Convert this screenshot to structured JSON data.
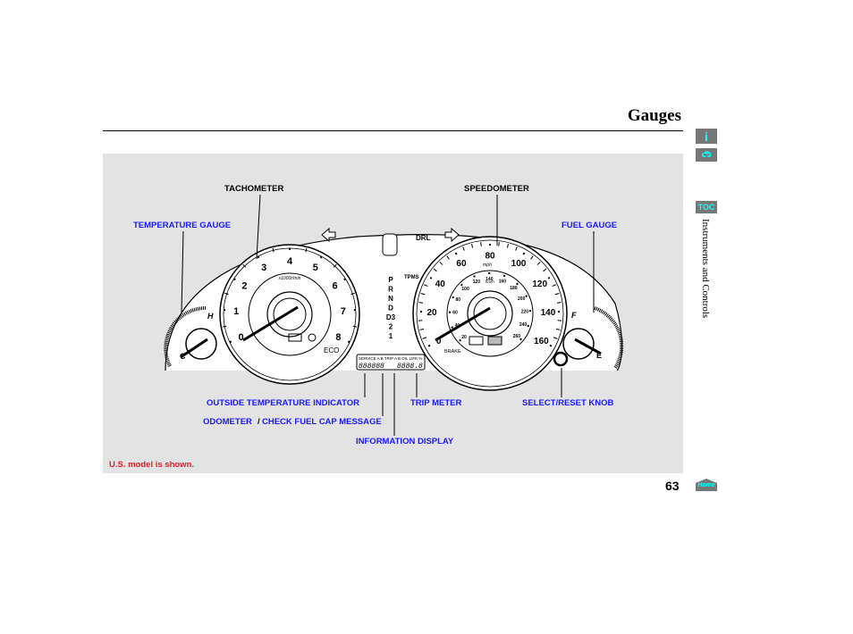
{
  "header": {
    "title": "Gauges",
    "page_number": "63"
  },
  "sidebar": {
    "info_icon": "info-icon",
    "car_icon": "car-icon",
    "toc_label": "TOC",
    "section": "Instruments and Controls",
    "home_label": "Home"
  },
  "labels": {
    "tachometer": "TACHOMETER",
    "speedometer": "SPEEDOMETER",
    "temperature_gauge": "TEMPERATURE GAUGE",
    "fuel_gauge": "FUEL GAUGE",
    "outside_temp": "OUTSIDE TEMPERATURE INDICATOR",
    "trip_meter": "TRIP METER",
    "select_reset": "SELECT/RESET KNOB",
    "odometer": "ODOMETER",
    "slash": "/",
    "check_fuel_cap": "CHECK FUEL CAP MESSAGE",
    "info_display": "INFORMATION DISPLAY",
    "note": "U.S. model is shown."
  },
  "cluster": {
    "tach_numbers": [
      "0",
      "1",
      "2",
      "3",
      "4",
      "5",
      "6",
      "7",
      "8"
    ],
    "tach_unit": "x1000r/min",
    "speed_mph": [
      "0",
      "20",
      "40",
      "60",
      "80",
      "100",
      "120",
      "140",
      "160"
    ],
    "speed_unit": "mph",
    "speed_kmh": [
      "20",
      "40",
      "60",
      "80",
      "100",
      "120",
      "140",
      "160",
      "180",
      "200",
      "220",
      "240",
      "260"
    ],
    "kmh_unit": "km/h",
    "gear": [
      "P",
      "R",
      "N",
      "D",
      "D3",
      "2",
      "1"
    ],
    "drl": "DRL",
    "tpms": "TPMS",
    "eco": "ECO",
    "brake": "BRAKE",
    "temp_h": "H",
    "temp_c": "C",
    "fuel_f": "F",
    "fuel_e": "E",
    "display_top": "SERVICE  A B TRIP A B OIL LIFE %",
    "odometer_digits": "888888",
    "trip_digits": "8888.8"
  }
}
